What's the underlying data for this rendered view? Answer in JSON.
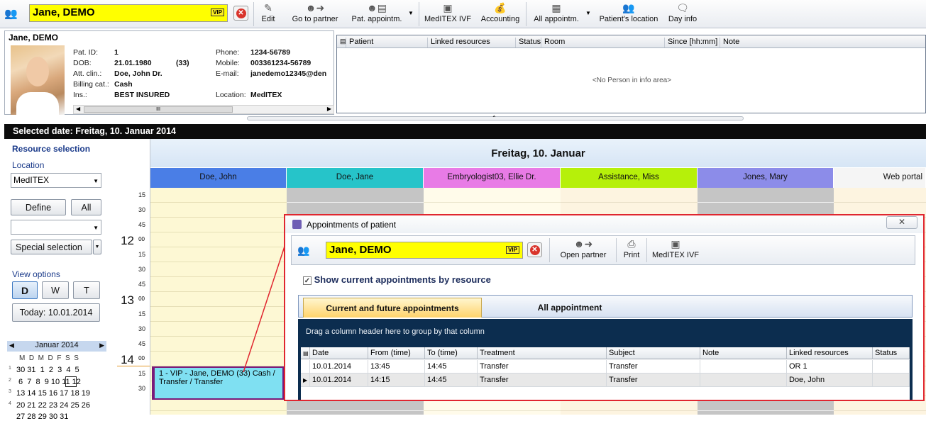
{
  "toolbar": {
    "patient_name": "Jane, DEMO",
    "vip": "VIP",
    "buttons": [
      "Edit",
      "Go to partner",
      "Pat. appointm.",
      "MedITEX IVF",
      "Accounting",
      "All appointm.",
      "Patient's location",
      "Day info"
    ]
  },
  "patient": {
    "name": "Jane, DEMO",
    "labels": {
      "pat_id": "Pat. ID:",
      "dob": "DOB:",
      "att_clin": "Att. clin.:",
      "billing": "Billing cat.:",
      "ins": "Ins.:",
      "phone": "Phone:",
      "mobile": "Mobile:",
      "email": "E-mail:",
      "location": "Location:"
    },
    "values": {
      "pat_id": "1",
      "dob": "21.01.1980",
      "age": "(33)",
      "att_clin": "Doe, John Dr.",
      "billing": "Cash",
      "ins": "BEST INSURED",
      "phone": "1234-56789",
      "mobile": "003361234-56789",
      "email": "janedemo12345@den",
      "location": "MedITEX"
    },
    "scroll_grip": "III"
  },
  "info_area": {
    "columns": [
      "Patient",
      "Linked resources",
      "Status",
      "Room",
      "Since [hh:mm]",
      "Note"
    ],
    "empty": "<No Person in info area>"
  },
  "selected_date": "Selected date: Freitag, 10. Januar 2014",
  "left": {
    "resource_selection": "Resource selection",
    "location_label": "Location",
    "location_value": "MedITEX",
    "define": "Define",
    "all": "All",
    "special_selection": "Special selection",
    "view_options": "View options",
    "views": [
      "D",
      "W",
      "T"
    ],
    "today": "Today: 10.01.2014",
    "calendar": {
      "month": "Januar 2014",
      "days_header": "M  D  M  D  F  S  S",
      "rows": [
        {
          "wk": "1",
          "days": "30 31  1  2  3  4  5"
        },
        {
          "wk": "2",
          "days": " 6  7  8  9 10 11 12"
        },
        {
          "wk": "3",
          "days": "13 14 15 16 17 18 19"
        },
        {
          "wk": "4",
          "days": "20 21 22 23 24 25 26"
        },
        {
          "wk": "5",
          "days": "27 28 29 30 31"
        }
      ]
    }
  },
  "times": {
    "hours": [
      "12",
      "13",
      "14"
    ],
    "hour_sup": "00",
    "quarters": [
      "15",
      "30",
      "45",
      "15",
      "30",
      "45",
      "15",
      "30",
      "45",
      "15",
      "30"
    ]
  },
  "day_header": "Freitag, 10. Januar",
  "resources": [
    {
      "name": "Doe, John",
      "color": "#4a7ee6"
    },
    {
      "name": "Doe, Jane",
      "color": "#26c4c9"
    },
    {
      "name": "Embryologist03, Ellie Dr.",
      "color": "#e87be6"
    },
    {
      "name": "Assistance, Miss",
      "color": "#b6f00a"
    },
    {
      "name": "Jones, Mary",
      "color": "#8c8ce9"
    },
    {
      "name": "Web portal",
      "color": "#f5f5f5"
    }
  ],
  "appointment": {
    "text": "1 - VIP - Jane, DEMO (33) Cash / Transfer / Transfer"
  },
  "dialog": {
    "title": "Appointments of patient",
    "patient_name": "Jane, DEMO",
    "vip": "VIP",
    "buttons": [
      "Open partner",
      "Print",
      "MedITEX IVF"
    ],
    "show_current": "Show current appointments by resource",
    "tabs": [
      "Current and future appointments",
      "All appointment"
    ],
    "group_hint": "Drag a column header here to group by that column",
    "columns": [
      "Date",
      "From (time)",
      "To (time)",
      "Treatment",
      "Subject",
      "Note",
      "Linked resources",
      "Status"
    ],
    "rows": [
      [
        "10.01.2014",
        "13:45",
        "14:45",
        "Transfer",
        "Transfer",
        "",
        "OR 1",
        ""
      ],
      [
        "10.01.2014",
        "14:15",
        "14:45",
        "Transfer",
        "Transfer",
        "",
        "Doe, John",
        ""
      ]
    ]
  }
}
